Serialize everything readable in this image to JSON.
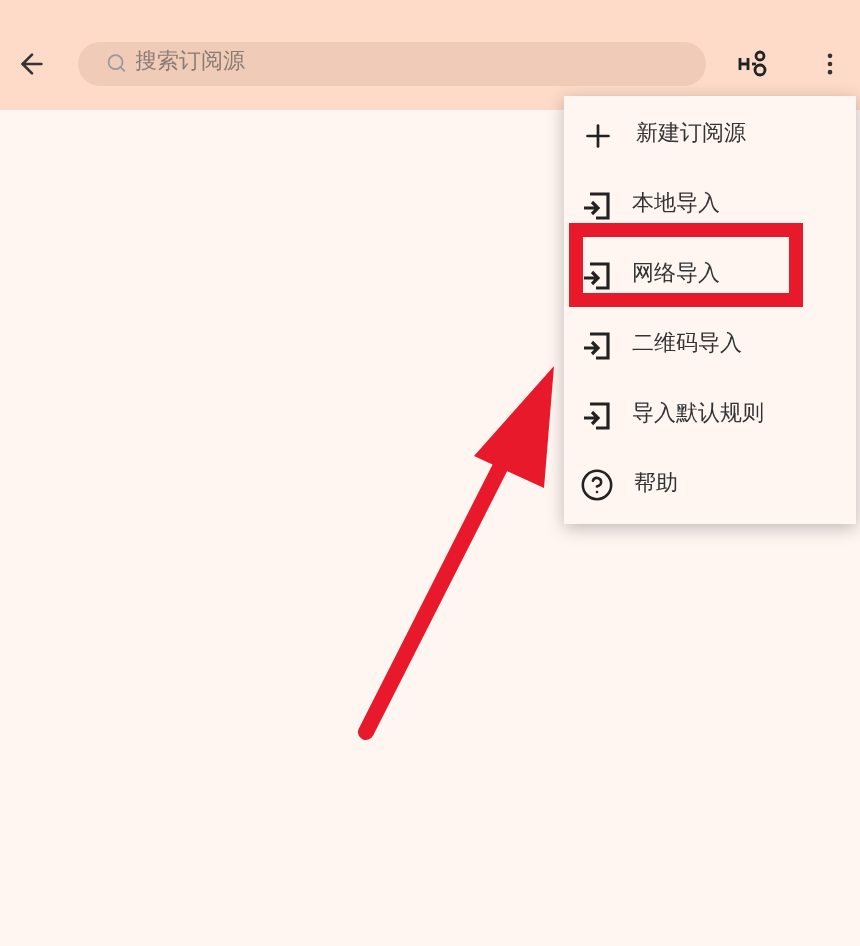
{
  "toolbar": {
    "search": {
      "placeholder": "搜索订阅源"
    }
  },
  "menu": {
    "items": [
      {
        "kind": "add",
        "label": "新建订阅源"
      },
      {
        "kind": "import",
        "label": "本地导入"
      },
      {
        "kind": "import",
        "label": "网络导入"
      },
      {
        "kind": "import",
        "label": "二维码导入"
      },
      {
        "kind": "import",
        "label": "导入默认规则"
      },
      {
        "kind": "help",
        "label": "帮助"
      }
    ]
  }
}
